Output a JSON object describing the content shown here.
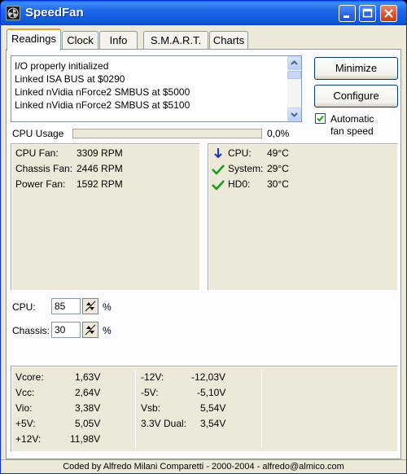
{
  "window": {
    "title": "SpeedFan"
  },
  "tabs": [
    {
      "label": "Readings"
    },
    {
      "label": "Clock"
    },
    {
      "label": "Info"
    },
    {
      "label": "S.M.A.R.T."
    },
    {
      "label": "Charts"
    }
  ],
  "log": [
    "I/O properly initialized",
    "Linked ISA BUS at $0290",
    "Linked nVidia nForce2 SMBUS at $5000",
    "Linked nVidia nForce2 SMBUS at $5100"
  ],
  "buttons": {
    "minimize": "Minimize",
    "configure": "Configure"
  },
  "auto_fan": {
    "label_line1": "Automatic",
    "label_line2": "fan speed",
    "checked": true
  },
  "cpu_usage": {
    "label": "CPU Usage",
    "value": "0,0%",
    "fraction": 0.0
  },
  "fans": [
    {
      "name": "CPU Fan:",
      "value": "3309 RPM"
    },
    {
      "name": "Chassis Fan:",
      "value": "2446 RPM"
    },
    {
      "name": "Power Fan:",
      "value": "1592 RPM"
    }
  ],
  "temps": [
    {
      "name": "CPU:",
      "value": "49°C",
      "status": "down-arrow-icon",
      "color": "#1830c8"
    },
    {
      "name": "System:",
      "value": "29°C",
      "status": "check-icon",
      "color": "#1a9a1a"
    },
    {
      "name": "HD0:",
      "value": "30°C",
      "status": "check-icon",
      "color": "#1a9a1a"
    }
  ],
  "speeds": [
    {
      "label": "CPU:",
      "value": "85",
      "unit": "%"
    },
    {
      "label": "Chassis:",
      "value": "30",
      "unit": "%"
    }
  ],
  "voltages": {
    "col1": [
      {
        "name": "Vcore:",
        "value": "1,63V"
      },
      {
        "name": "Vcc:",
        "value": "2,64V"
      },
      {
        "name": "Vio:",
        "value": "3,38V"
      },
      {
        "name": "+5V:",
        "value": "5,05V"
      },
      {
        "name": "+12V:",
        "value": "11,98V"
      }
    ],
    "col2": [
      {
        "name": "-12V:",
        "value": "-12,03V"
      },
      {
        "name": "-5V:",
        "value": "-5,10V"
      },
      {
        "name": "Vsb:",
        "value": "5,54V"
      },
      {
        "name": "3.3V Dual:",
        "value": "3,54V"
      }
    ]
  },
  "footer": "Coded by Alfredo Milani Comparetti - 2000-2004 - alfredo@almico.com"
}
